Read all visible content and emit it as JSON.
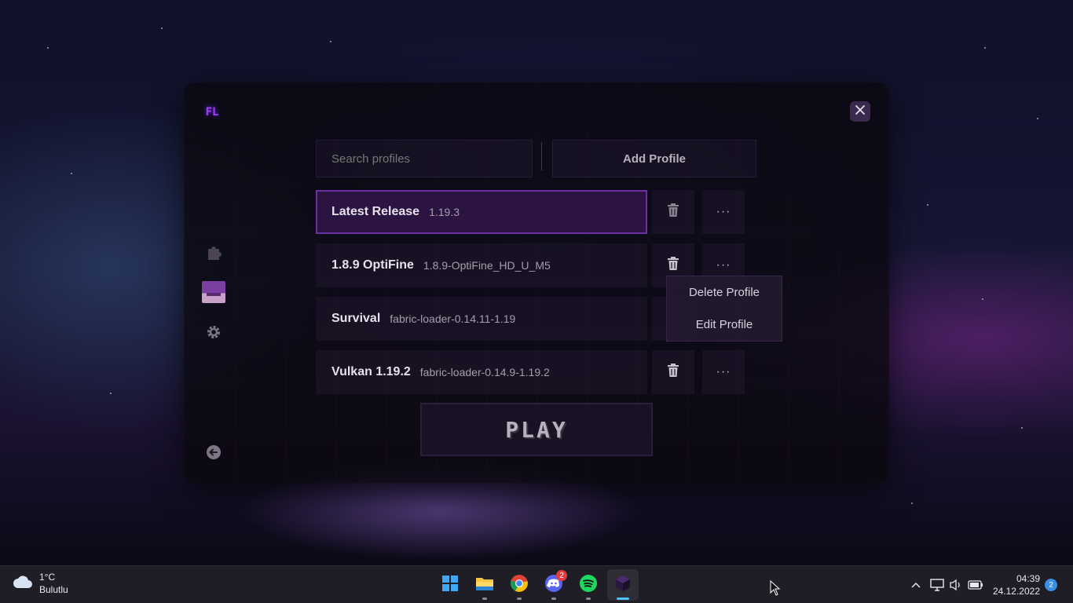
{
  "launcher": {
    "logo": "FL",
    "search": {
      "placeholder": "Search profiles",
      "value": ""
    },
    "add_profile_label": "Add Profile",
    "profiles": [
      {
        "name": "Latest Release",
        "version": "1.19.3",
        "selected": true
      },
      {
        "name": "1.8.9 OptiFine",
        "version": "1.8.9-OptiFine_HD_U_M5",
        "selected": false
      },
      {
        "name": "Survival",
        "version": "fabric-loader-0.14.11-1.19",
        "selected": false
      },
      {
        "name": "Vulkan 1.19.2",
        "version": "fabric-loader-0.14.9-1.19.2",
        "selected": false
      }
    ],
    "more_label": "···",
    "context_menu": {
      "delete_label": "Delete Profile",
      "edit_label": "Edit Profile"
    },
    "play_label": "PLAY",
    "accent_color": "#6a2fa0"
  },
  "sidebar": {
    "icons": [
      "puzzle-icon",
      "avatar",
      "gear-icon",
      "back-arrow-icon"
    ]
  },
  "taskbar": {
    "weather": {
      "temp": "1°C",
      "condition": "Bulutlu"
    },
    "apps": [
      "start",
      "file-explorer",
      "chrome",
      "discord",
      "spotify",
      "minecraft"
    ],
    "discord_badge": "2",
    "time": "04:39",
    "date": "24.12.2022",
    "notification_count": "2"
  }
}
